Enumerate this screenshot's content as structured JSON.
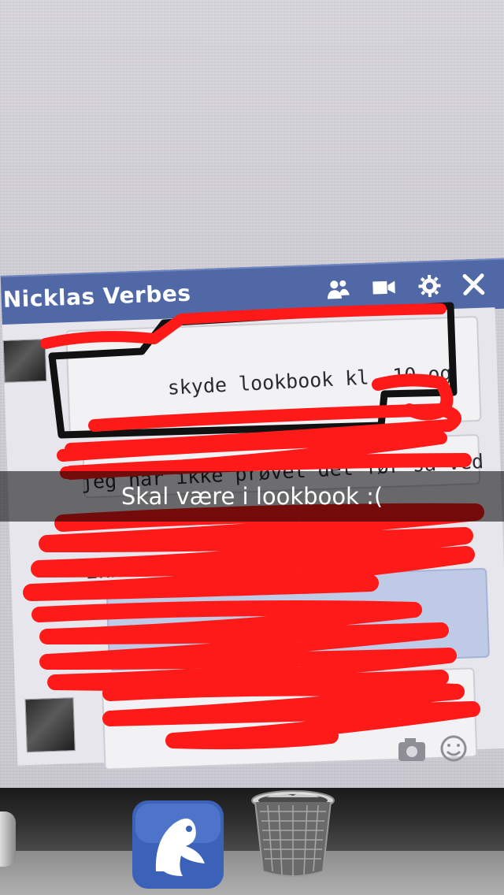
{
  "chat": {
    "title": "Nicklas Verbes",
    "header_icons": [
      "add-friend-icon",
      "video-call-icon",
      "settings-gear-icon",
      "close-icon"
    ],
    "message_lines": [
      "skyde lookbook kl. 10 og",
      "jeg har ikke prøvet det før så ved",
      "ikke hvornår vi er færdige."
    ],
    "footer_icons": [
      "camera-icon",
      "emoji-icon"
    ]
  },
  "caption": {
    "text": "Skal være i lookbook :("
  },
  "dock": {
    "items": [
      "app-icon",
      "trash-icon"
    ]
  },
  "colors": {
    "header_blue": "#5068a6",
    "scribble_red": "#ff1a1a",
    "outline_black": "#111111",
    "caption_bg": "rgba(0,0,0,0.55)"
  }
}
